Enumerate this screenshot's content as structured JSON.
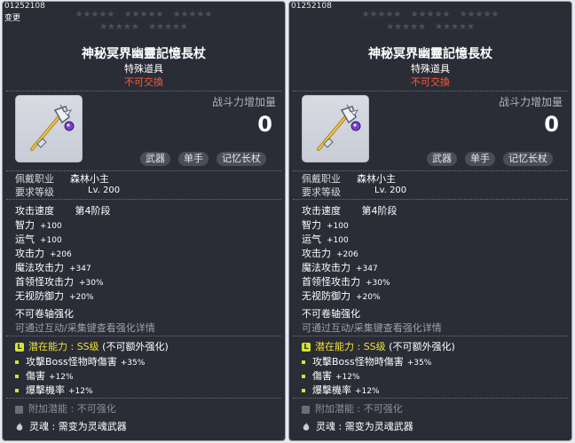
{
  "panels": [
    {
      "code": "01252108",
      "change": "变更",
      "stars_row1": [
        "★★★★★",
        "★★★★★",
        "★★★★★"
      ],
      "stars_row2": [
        "★★★★★",
        "★★★★★"
      ],
      "title": "神秘冥界幽靈記憶長杖",
      "subtitle": "特殊道具",
      "untradeable": "不可交換",
      "power_label": "战斗力增加量",
      "power_value": "0",
      "tags": [
        "武器",
        "单手",
        "记忆长杖"
      ],
      "job_label": "佩戴职业",
      "job_value": "森林小主",
      "level_label": "要求等级",
      "level_value": "Lv. 200",
      "atk_speed_label": "攻击速度",
      "atk_speed_value": "第4阶段",
      "stats": [
        {
          "label": "智力",
          "value": "+100"
        },
        {
          "label": "运气",
          "value": "+100"
        },
        {
          "label": "攻击力",
          "value": "+206"
        },
        {
          "label": "魔法攻击力",
          "value": "+347"
        },
        {
          "label": "首领怪攻击力",
          "value": "+30%"
        },
        {
          "label": "无视防御力",
          "value": "+20%"
        }
      ],
      "no_scroll": "不可卷轴强化",
      "enhance_hint": "可通过互动/采集键查看强化详情",
      "potential_prefix": "潜在能力 : ",
      "potential_grade": "SS级",
      "potential_note": "(不可额外强化)",
      "potential_badge": "L",
      "potential_lines": [
        {
          "label": "攻擊Boss怪物時傷害",
          "value": "+35%"
        },
        {
          "label": "傷害",
          "value": "+12%"
        },
        {
          "label": "爆擊機率",
          "value": "+12%"
        }
      ],
      "additional_potential": "附加潜能 : 不可强化",
      "soul": "灵魂 : 需变为灵魂武器"
    },
    {
      "code": "01252108",
      "stars_row1": [
        "★★★★★",
        "★★★★★",
        "★★★★★"
      ],
      "stars_row2": [
        "★★★★★",
        "★★★★★"
      ],
      "title": "神秘冥界幽靈記憶長杖",
      "subtitle": "特殊道具",
      "untradeable": "不可交換",
      "power_label": "战斗力增加量",
      "power_value": "0",
      "tags": [
        "武器",
        "单手",
        "记忆长杖"
      ],
      "job_label": "佩戴职业",
      "job_value": "森林小主",
      "level_label": "要求等级",
      "level_value": "Lv. 200",
      "atk_speed_label": "攻击速度",
      "atk_speed_value": "第4阶段",
      "stats": [
        {
          "label": "智力",
          "value": "+100"
        },
        {
          "label": "运气",
          "value": "+100"
        },
        {
          "label": "攻击力",
          "value": "+206"
        },
        {
          "label": "魔法攻击力",
          "value": "+347"
        },
        {
          "label": "首领怪攻击力",
          "value": "+30%"
        },
        {
          "label": "无视防御力",
          "value": "+20%"
        }
      ],
      "no_scroll": "不可卷轴强化",
      "enhance_hint": "可通过互动/采集键查看强化详情",
      "potential_prefix": "潜在能力 : ",
      "potential_grade": "SS级",
      "potential_note": "(不可额外强化)",
      "potential_badge": "L",
      "potential_lines": [
        {
          "label": "攻擊Boss怪物時傷害",
          "value": "+35%"
        },
        {
          "label": "傷害",
          "value": "+12%"
        },
        {
          "label": "爆擊機率",
          "value": "+12%"
        }
      ],
      "additional_potential": "附加潜能 : 不可强化",
      "soul": "灵魂 : 需变为灵魂武器"
    }
  ],
  "colors": {
    "panel_bg": "#2a2c36",
    "untradeable": "#ff5a3a",
    "potential_highlight": "#f2e33a",
    "badge": "#d6e52c",
    "star_empty": "#4d5059"
  },
  "icons": {
    "item": "staff-icon",
    "potential_badge": "legendary-badge-icon",
    "bullet": "bullet-icon",
    "lock": "lock-icon",
    "soul": "flame-icon"
  }
}
